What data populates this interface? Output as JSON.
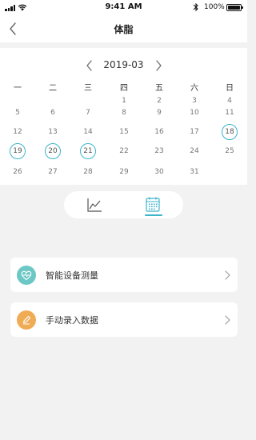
{
  "status_bar": {
    "time": "9:41 AM",
    "battery": "100%"
  },
  "nav": {
    "title": "体脂",
    "back_icon": "chevron-left-icon"
  },
  "calendar": {
    "month": "2019-03",
    "weekdays": [
      "一",
      "二",
      "三",
      "四",
      "五",
      "六",
      "日"
    ],
    "weeks": [
      [
        "",
        "",
        "",
        "",
        "",
        "",
        ""
      ],
      [
        "",
        "",
        "",
        "1",
        "2",
        "3",
        "4"
      ],
      [
        "5",
        "6",
        "7",
        "8",
        "9",
        "10",
        "11"
      ],
      [
        "12",
        "13",
        "14",
        "15",
        "16",
        "17",
        "18"
      ],
      [
        "19",
        "20",
        "21",
        "22",
        "23",
        "24",
        "25"
      ],
      [
        "26",
        "27",
        "28",
        "29",
        "30",
        "31",
        ""
      ]
    ],
    "marked_days": [
      "18",
      "19",
      "20",
      "21"
    ],
    "accent_color": "#3db5cb"
  },
  "view_tabs": [
    {
      "name": "trend-chart",
      "icon": "line-chart-icon",
      "selected": false
    },
    {
      "name": "calendar",
      "icon": "calendar-icon",
      "selected": true
    }
  ],
  "actions": [
    {
      "label": "智能设备测量",
      "icon": "heart-monitor-icon",
      "color": "#6dc8c5"
    },
    {
      "label": "手动录入数据",
      "icon": "pencil-icon",
      "color": "#f0ab55"
    }
  ]
}
